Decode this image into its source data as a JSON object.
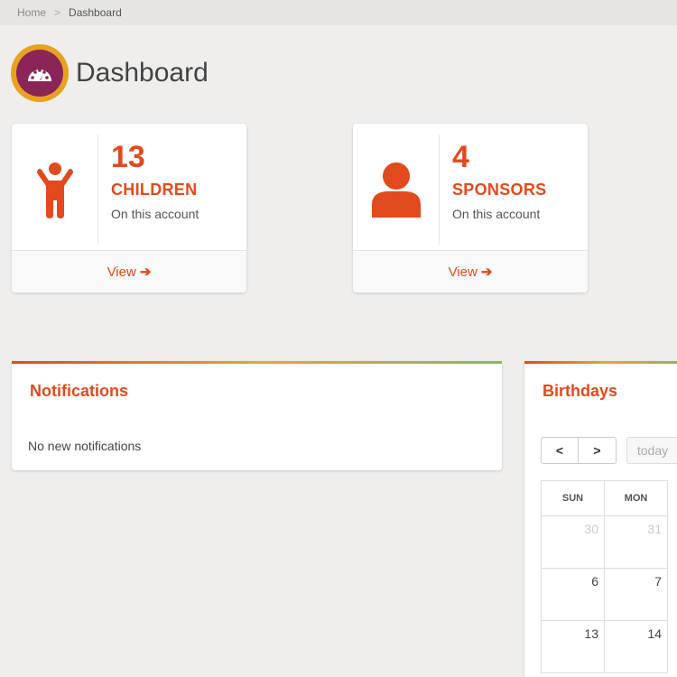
{
  "breadcrumb": {
    "home": "Home",
    "separator": ">",
    "current": "Dashboard"
  },
  "page": {
    "title": "Dashboard"
  },
  "stats": [
    {
      "count": "13",
      "label": "CHILDREN",
      "sub": "On this account",
      "link": "View",
      "icon": "child-icon"
    },
    {
      "count": "4",
      "label": "SPONSORS",
      "sub": "On this account",
      "link": "View",
      "icon": "person-icon"
    }
  ],
  "notifications": {
    "title": "Notifications",
    "empty_text": "No new notifications"
  },
  "birthdays": {
    "title": "Birthdays",
    "prev": "<",
    "next": ">",
    "today": "today",
    "weekdays": [
      "SUN",
      "MON"
    ],
    "rows": [
      [
        "30",
        "31"
      ],
      [
        "6",
        "7"
      ],
      [
        "13",
        "14"
      ]
    ]
  },
  "colors": {
    "accent": "#e14a1d",
    "badge_outer": "#e7a21f",
    "badge_inner": "#8b2457"
  }
}
